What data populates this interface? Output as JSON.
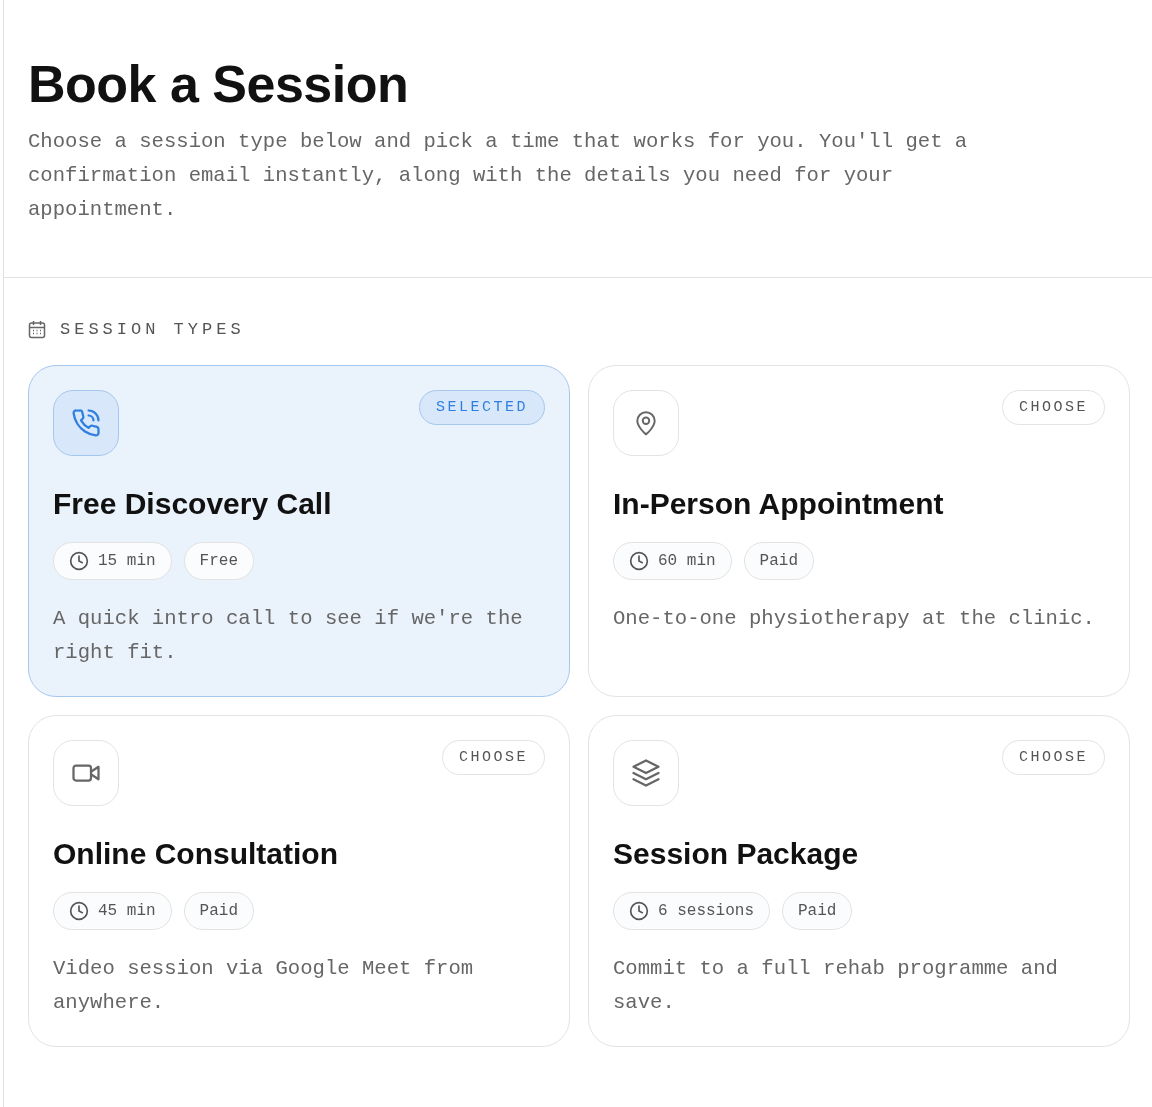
{
  "header": {
    "title": "Book a Session",
    "description": "Choose a session type below and pick a time that works for you. You'll get a confirmation email instantly, along with the details you need for your appointment."
  },
  "section": {
    "label": "SESSION TYPES"
  },
  "cards": [
    {
      "kind": "phone",
      "badge": "SELECTED",
      "selected": true,
      "title": "Free Discovery Call",
      "duration": "15 min",
      "price": "Free",
      "description": "A quick intro call to see if we're the right fit."
    },
    {
      "kind": "pin",
      "badge": "CHOOSE",
      "selected": false,
      "title": "In-Person Appointment",
      "duration": "60 min",
      "price": "Paid",
      "description": "One-to-one physiotherapy at the clinic."
    },
    {
      "kind": "video",
      "badge": "CHOOSE",
      "selected": false,
      "title": "Online Consultation",
      "duration": "45 min",
      "price": "Paid",
      "description": "Video session via Google Meet from anywhere."
    },
    {
      "kind": "layers",
      "badge": "CHOOSE",
      "selected": false,
      "title": "Session Package",
      "duration": "6 sessions",
      "price": "Paid",
      "description": "Commit to a full rehab programme and save."
    }
  ]
}
